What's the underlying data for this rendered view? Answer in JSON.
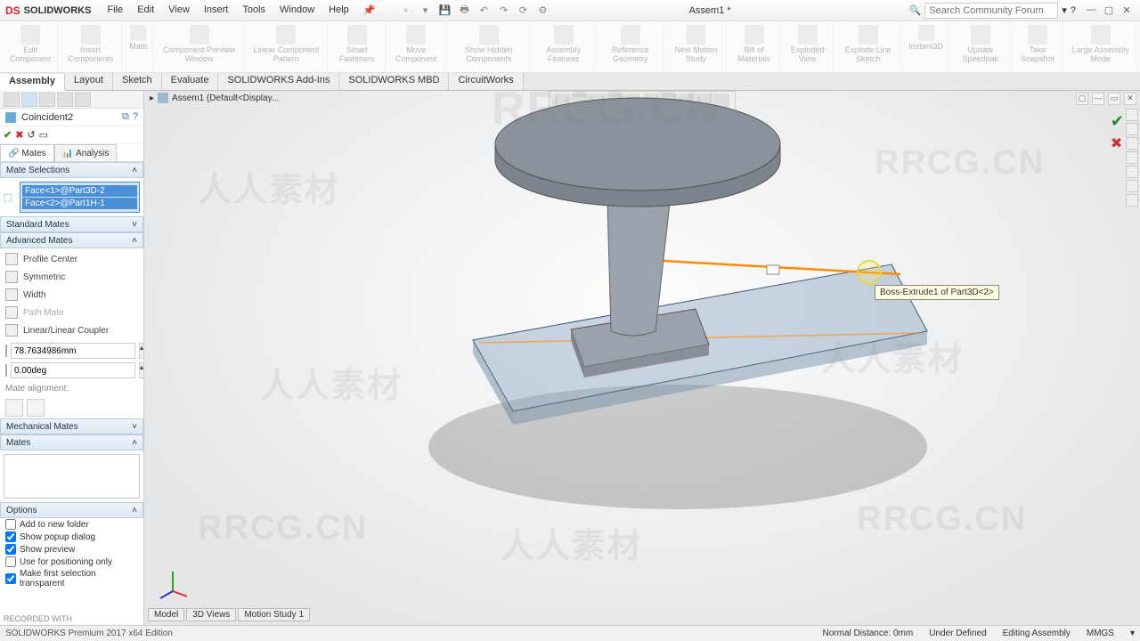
{
  "app": {
    "brand": "SOLIDWORKS",
    "doc": "Assem1 *"
  },
  "menu": [
    "File",
    "Edit",
    "View",
    "Insert",
    "Tools",
    "Window",
    "Help"
  ],
  "search": {
    "placeholder": "Search Community Forum"
  },
  "ribbon_groups": [
    "Edit Component",
    "Insert Components",
    "Mate",
    "Component Preview Window",
    "Linear Component Pattern",
    "Smart Fasteners",
    "Move Component",
    "Show Hidden Components",
    "Assembly Features",
    "Reference Geometry",
    "New Motion Study",
    "Bill of Materials",
    "Exploded View",
    "Explode Line Sketch",
    "Instant3D",
    "Update Speedpak",
    "Take Snapshot",
    "Large Assembly Mode"
  ],
  "cmd_tabs": [
    "Assembly",
    "Layout",
    "Sketch",
    "Evaluate",
    "SOLIDWORKS Add-Ins",
    "SOLIDWORKS MBD",
    "CircuitWorks"
  ],
  "crumb": "Assem1 (Default<Display...",
  "pm": {
    "title": "Coincident2",
    "sub_tabs": {
      "mates": "Mates",
      "analysis": "Analysis"
    },
    "sections": {
      "mate_selections": "Mate Selections",
      "standard": "Standard Mates",
      "advanced": "Advanced Mates",
      "mechanical": "Mechanical Mates",
      "mates": "Mates",
      "options": "Options"
    },
    "selections": [
      "Face<1>@Part3D-2",
      "Face<2>@Part1H-1"
    ],
    "adv_items": [
      "Profile Center",
      "Symmetric",
      "Width",
      "Path Mate",
      "Linear/Linear Coupler"
    ],
    "dist": "78.7634986mm",
    "angle": "0.00deg",
    "align_label": "Mate alignment:",
    "options_chk": [
      {
        "label": "Add to new folder",
        "checked": false
      },
      {
        "label": "Show popup dialog",
        "checked": true
      },
      {
        "label": "Show preview",
        "checked": true
      },
      {
        "label": "Use for positioning only",
        "checked": false
      },
      {
        "label": "Make first selection transparent",
        "checked": true
      }
    ]
  },
  "tooltip": "Boss-Extrude1 of Part3D<2>",
  "bottom_tabs": [
    "Model",
    "3D Views",
    "Motion Study 1"
  ],
  "status": {
    "left": "SOLIDWORKS Premium 2017 x64 Edition",
    "dist": "Normal Distance: 0mm",
    "def": "Under Defined",
    "mode": "Editing Assembly",
    "units": "MMGS"
  },
  "watermarks": [
    "RRCG.CN",
    "人人素材"
  ],
  "recorded": "RECORDED WITH"
}
